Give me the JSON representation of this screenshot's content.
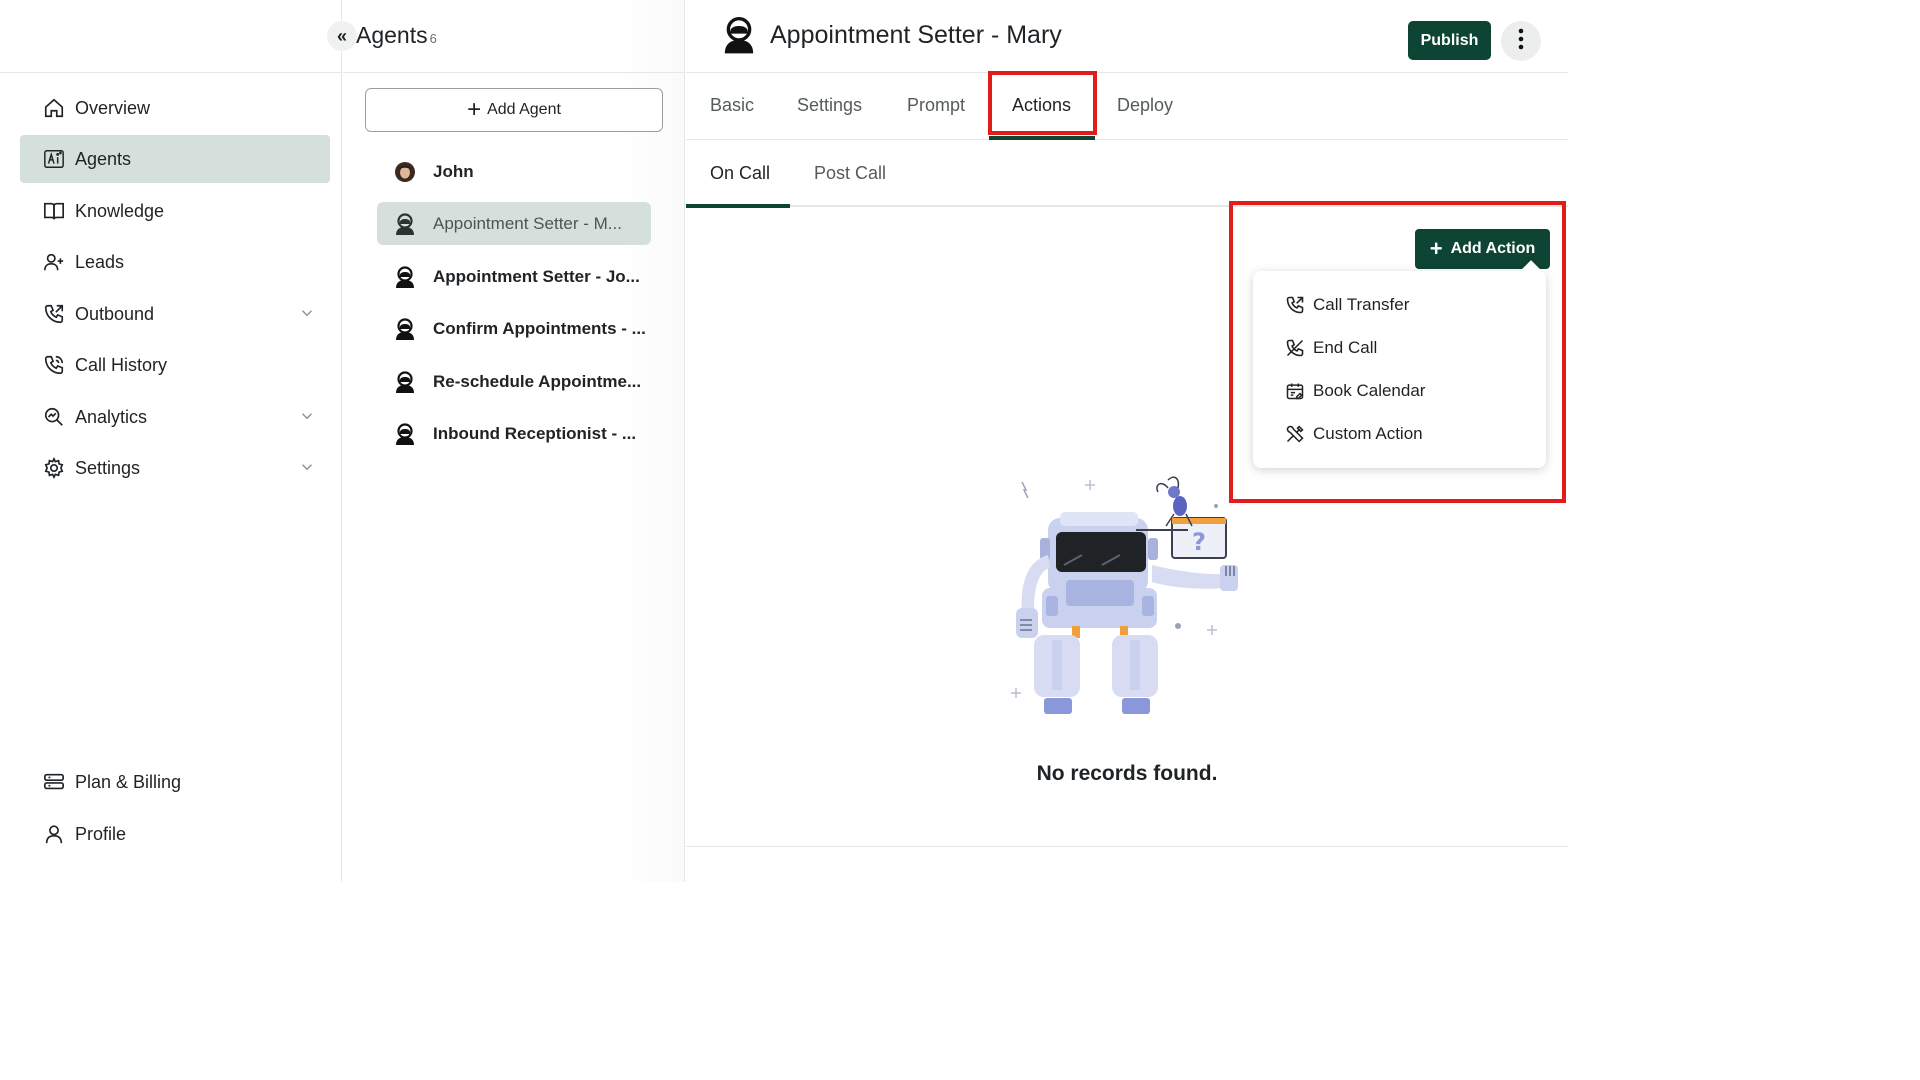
{
  "sidebar": {
    "items": [
      {
        "label": "Overview"
      },
      {
        "label": "Agents"
      },
      {
        "label": "Knowledge"
      },
      {
        "label": "Leads"
      },
      {
        "label": "Outbound"
      },
      {
        "label": "Call History"
      },
      {
        "label": "Analytics"
      },
      {
        "label": "Settings"
      }
    ],
    "bottom": [
      {
        "label": "Plan & Billing"
      },
      {
        "label": "Profile"
      }
    ]
  },
  "agents": {
    "title": "Agents",
    "count": "6",
    "add_label": "Add Agent",
    "list": [
      {
        "name": "John"
      },
      {
        "name": "Appointment Setter - M..."
      },
      {
        "name": "Appointment Setter - Jo..."
      },
      {
        "name": "Confirm Appointments - ..."
      },
      {
        "name": "Re-schedule Appointme..."
      },
      {
        "name": "Inbound Receptionist - ..."
      }
    ]
  },
  "main": {
    "title": "Appointment Setter - Mary",
    "publish_label": "Publish",
    "tabs": [
      {
        "label": "Basic"
      },
      {
        "label": "Settings"
      },
      {
        "label": "Prompt"
      },
      {
        "label": "Actions"
      },
      {
        "label": "Deploy"
      }
    ],
    "active_tab": "Actions",
    "subtabs": [
      {
        "label": "On Call"
      },
      {
        "label": "Post Call"
      }
    ],
    "active_subtab": "On Call",
    "add_action_label": "Add Action",
    "action_menu": [
      {
        "label": "Call Transfer",
        "icon": "call-transfer-icon"
      },
      {
        "label": "End Call",
        "icon": "end-call-icon"
      },
      {
        "label": "Book Calendar",
        "icon": "calendar-icon"
      },
      {
        "label": "Custom Action",
        "icon": "tools-icon"
      }
    ],
    "empty_text": "No records found."
  },
  "colors": {
    "brand": "#0e4433",
    "active_bg": "#d5e0dc",
    "highlight": "#e21b1b"
  }
}
